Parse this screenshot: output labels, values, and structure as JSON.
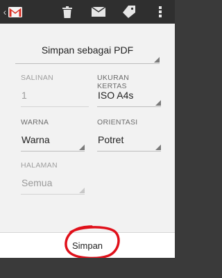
{
  "toolbar": {
    "icons": [
      "back-arrow",
      "gmail-logo",
      "trash-icon",
      "mail-icon",
      "tag-icon",
      "more-icon"
    ]
  },
  "print_dialog": {
    "destination": "Simpan sebagai PDF",
    "copies": {
      "label": "SALINAN",
      "value": "1",
      "enabled": false
    },
    "paper_size": {
      "label": "UKURAN KERTAS",
      "value": "ISO A4s"
    },
    "color": {
      "label": "WARNA",
      "value": "Warna"
    },
    "orientation": {
      "label": "ORIENTASI",
      "value": "Potret"
    },
    "pages": {
      "label": "HALAMAN",
      "value": "Semua",
      "enabled": false
    },
    "save_button": "Simpan"
  },
  "colors": {
    "toolbar_bg": "#2f2f2f",
    "panel_bg": "#f2f2f2",
    "annotation_red": "#e0101a"
  }
}
